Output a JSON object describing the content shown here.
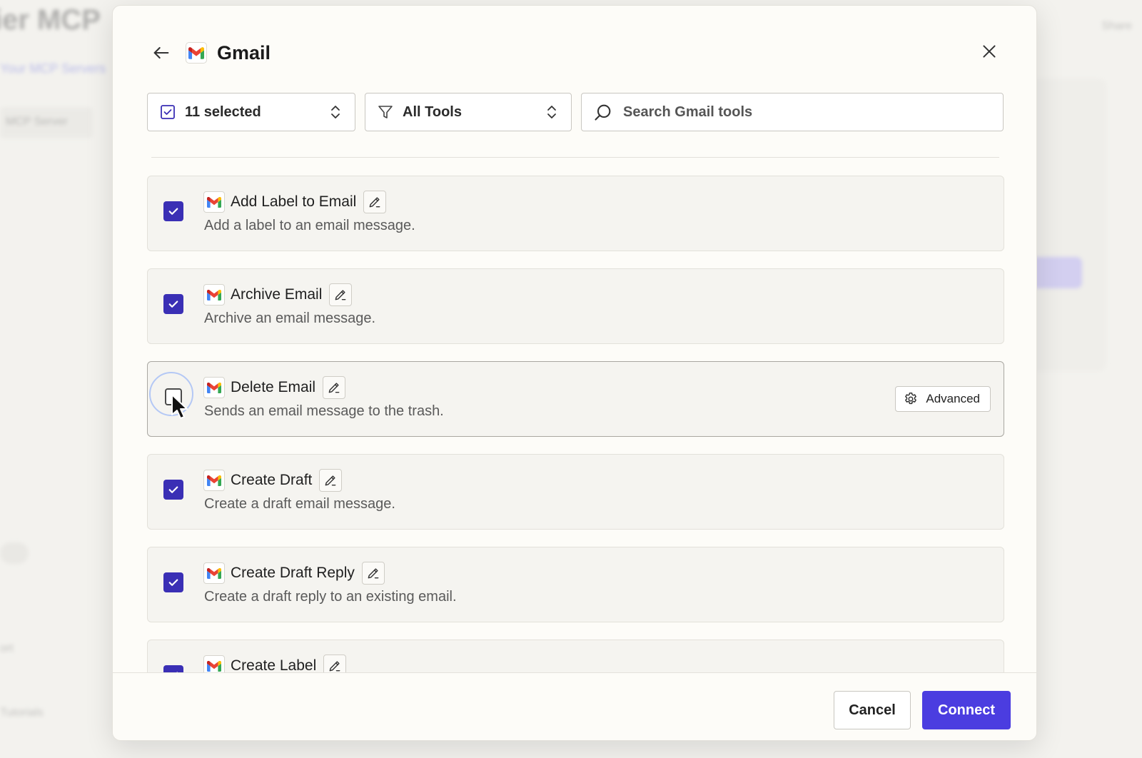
{
  "background": {
    "title": "ier MCP",
    "link": "Your MCP Servers",
    "tab": "MCP Server",
    "right_label": "Share",
    "side_label_1": "ort",
    "side_label_2": "Tutorials"
  },
  "dialog": {
    "app_name": "Gmail",
    "app_icon": "gmail-logo",
    "back_icon": "arrow-left-icon",
    "close_icon": "close-icon"
  },
  "filters": {
    "selection_label": "11 selected",
    "tools_label": "All Tools",
    "search_placeholder": "Search Gmail tools"
  },
  "tools": [
    {
      "name": "Add Label to Email",
      "description": "Add a label to an email message.",
      "checked": true
    },
    {
      "name": "Archive Email",
      "description": "Archive an email message.",
      "checked": true
    },
    {
      "name": "Delete Email",
      "description": "Sends an email message to the trash.",
      "checked": false,
      "advanced_label": "Advanced"
    },
    {
      "name": "Create Draft",
      "description": "Create a draft email message.",
      "checked": true
    },
    {
      "name": "Create Draft Reply",
      "description": "Create a draft reply to an existing email.",
      "checked": true
    },
    {
      "name": "Create Label",
      "description": "",
      "checked": true
    }
  ],
  "footer": {
    "cancel_label": "Cancel",
    "connect_label": "Connect"
  },
  "colors": {
    "accent": "#4b3de0",
    "checkbox": "#3a2fb5"
  }
}
